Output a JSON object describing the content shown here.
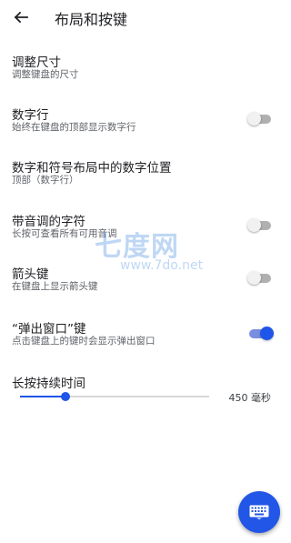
{
  "appbar": {
    "title": "布局和按键"
  },
  "settings": [
    {
      "title": "调整尺寸",
      "subtitle": "调整键盘的尺寸"
    },
    {
      "title": "数字行",
      "subtitle": "始终在键盘的顶部显示数字行",
      "enabled": false
    },
    {
      "title": "数字和符号布局中的数字位置",
      "subtitle": "顶部（数字行）"
    },
    {
      "title": "带音调的字符",
      "subtitle": "长按可查看所有可用音调",
      "enabled": false
    },
    {
      "title": "箭头键",
      "subtitle": "在键盘上显示箭头键",
      "enabled": false
    },
    {
      "title": "“弹出窗口”键",
      "subtitle": "点击键盘上的键时会显示弹出窗口",
      "enabled": true
    }
  ],
  "long_press": {
    "title": "长按持续时间",
    "value_label": "450 毫秒",
    "fraction": 0.24
  },
  "watermark": {
    "logo": "七度网",
    "url": "www.7do.net"
  },
  "colors": {
    "accent": "#1f55e8",
    "switch_off_track": "#b0b0b0"
  },
  "icons": {
    "back": "arrow-left-icon",
    "fab": "keyboard-icon"
  }
}
